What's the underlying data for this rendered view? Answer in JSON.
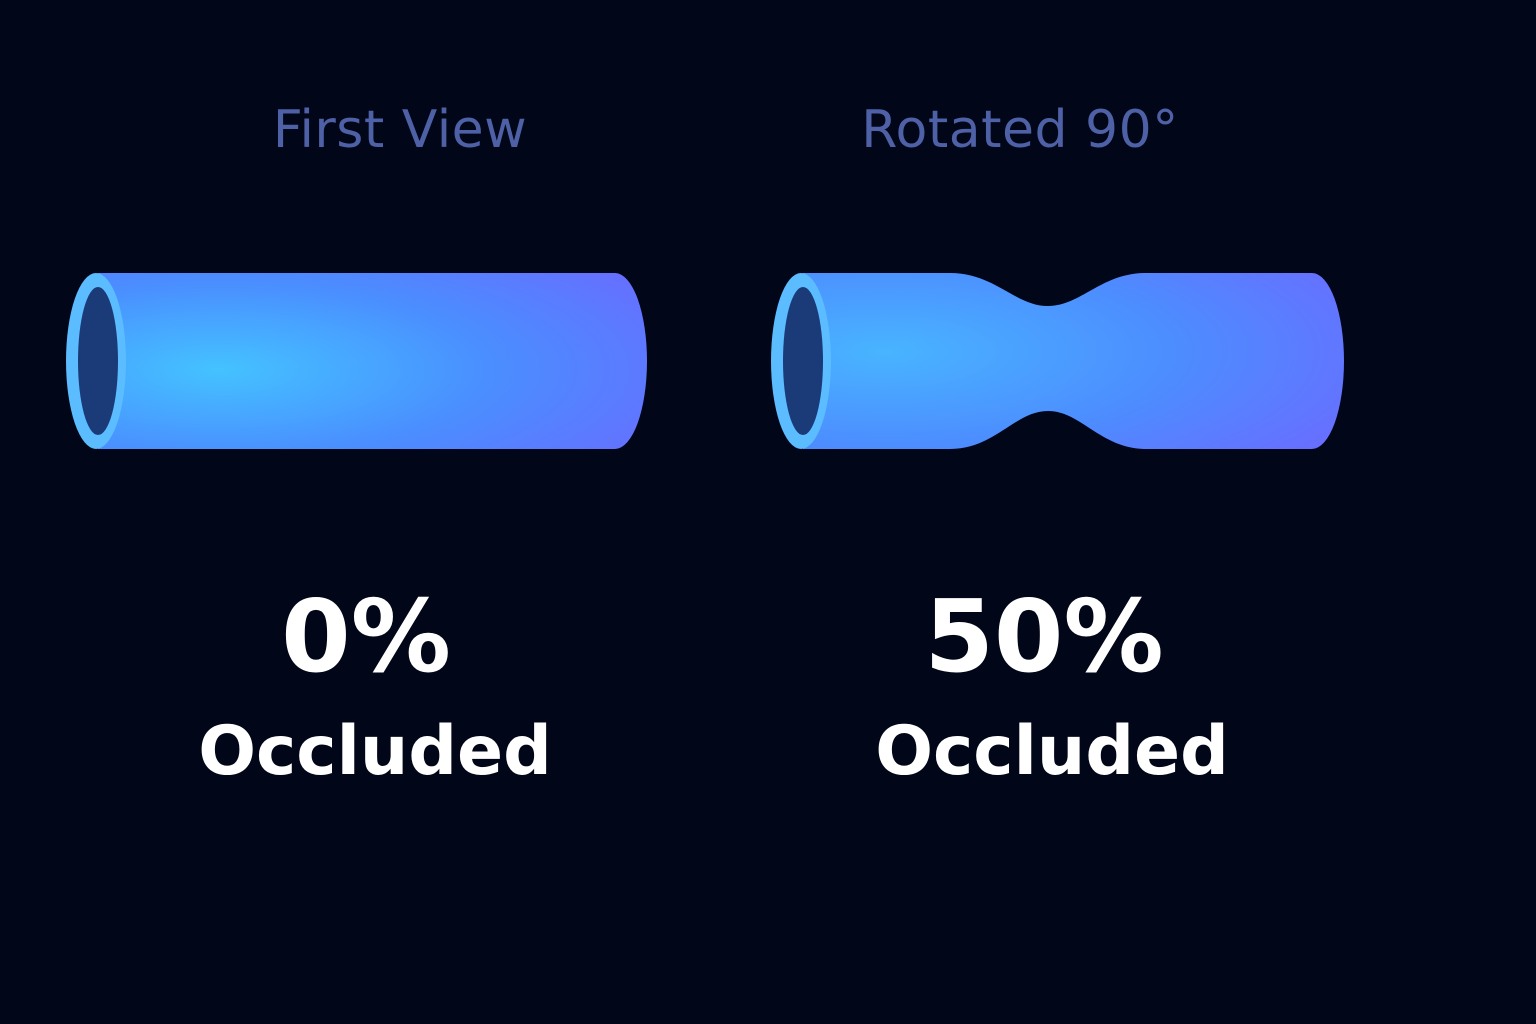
{
  "colors": {
    "background": "#010618",
    "title": "#4e60a6",
    "text": "#ffffff",
    "vessel_light": "#44c0ff",
    "vessel_dark": "#6a70ff",
    "lumen": "#1b3a78",
    "rim": "#5ab8ff"
  },
  "panels": [
    {
      "title": "First View",
      "percent": "0%",
      "label": "Occluded",
      "occlusion": 0
    },
    {
      "title": "Rotated 90°",
      "percent": "50%",
      "label": "Occluded",
      "occlusion": 0.5
    }
  ]
}
